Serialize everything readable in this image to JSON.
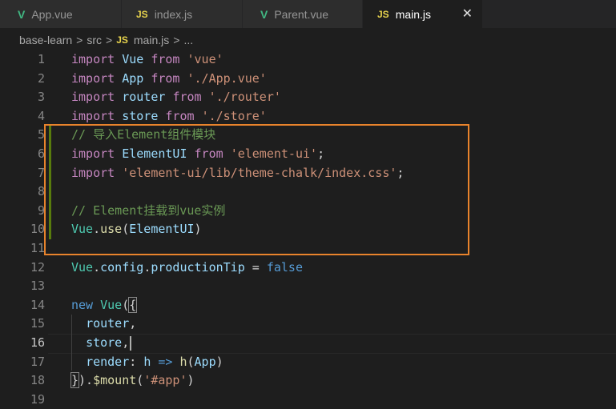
{
  "tabs": [
    {
      "label": "App.vue",
      "icon": "vue-icon"
    },
    {
      "label": "index.js",
      "icon": "js-icon"
    },
    {
      "label": "Parent.vue",
      "icon": "vue-icon"
    },
    {
      "label": "main.js",
      "icon": "js-icon"
    }
  ],
  "tab_icons": {
    "vue": "V",
    "js": "JS",
    "close": "✕"
  },
  "breadcrumb": {
    "root": "base-learn",
    "folder": "src",
    "file": "main.js",
    "more": "...",
    "separator": ">"
  },
  "lines": [
    {
      "n": "1",
      "t": [
        [
          "import",
          "kw"
        ],
        [
          " "
        ],
        [
          "Vue",
          "id"
        ],
        [
          " "
        ],
        [
          "from",
          "kw"
        ],
        [
          " "
        ],
        [
          "'vue'",
          "str"
        ]
      ]
    },
    {
      "n": "2",
      "t": [
        [
          "import",
          "kw"
        ],
        [
          " "
        ],
        [
          "App",
          "id"
        ],
        [
          " "
        ],
        [
          "from",
          "kw"
        ],
        [
          " "
        ],
        [
          "'./App.vue'",
          "str"
        ]
      ]
    },
    {
      "n": "3",
      "t": [
        [
          "import",
          "kw"
        ],
        [
          " "
        ],
        [
          "router",
          "id"
        ],
        [
          " "
        ],
        [
          "from",
          "kw"
        ],
        [
          " "
        ],
        [
          "'./router'",
          "str"
        ]
      ]
    },
    {
      "n": "4",
      "t": [
        [
          "import",
          "kw"
        ],
        [
          " "
        ],
        [
          "store",
          "id"
        ],
        [
          " "
        ],
        [
          "from",
          "kw"
        ],
        [
          " "
        ],
        [
          "'./store'",
          "str"
        ]
      ]
    },
    {
      "n": "5",
      "t": [
        [
          "// 导入Element组件模块",
          "cm"
        ]
      ]
    },
    {
      "n": "6",
      "t": [
        [
          "import",
          "kw"
        ],
        [
          " "
        ],
        [
          "ElementUI",
          "id"
        ],
        [
          " "
        ],
        [
          "from",
          "kw"
        ],
        [
          " "
        ],
        [
          "'element-ui'",
          "str"
        ],
        [
          ";"
        ]
      ]
    },
    {
      "n": "7",
      "t": [
        [
          "import",
          "kw"
        ],
        [
          " "
        ],
        [
          "'element-ui/lib/theme-chalk/index.css'",
          "str"
        ],
        [
          ";"
        ]
      ]
    },
    {
      "n": "8",
      "t": []
    },
    {
      "n": "9",
      "t": [
        [
          "// Element挂载到vue实例",
          "cm"
        ]
      ]
    },
    {
      "n": "10",
      "t": [
        [
          "Vue",
          "cls"
        ],
        [
          "."
        ],
        [
          "use",
          "fn"
        ],
        [
          "("
        ],
        [
          "ElementUI",
          "id"
        ],
        [
          ")"
        ]
      ]
    },
    {
      "n": "11",
      "t": []
    },
    {
      "n": "12",
      "t": [
        [
          "Vue",
          "cls"
        ],
        [
          "."
        ],
        [
          "config",
          "id"
        ],
        [
          "."
        ],
        [
          "productionTip",
          "id"
        ],
        [
          " = "
        ],
        [
          "false",
          "k"
        ]
      ]
    },
    {
      "n": "13",
      "t": []
    },
    {
      "n": "14",
      "t": [
        [
          "new",
          "k"
        ],
        [
          " "
        ],
        [
          "Vue",
          "cls"
        ],
        [
          "("
        ],
        [
          "{",
          "br"
        ]
      ]
    },
    {
      "n": "15",
      "t": [
        [
          "  "
        ],
        [
          "router",
          "id"
        ],
        [
          ","
        ]
      ]
    },
    {
      "n": "16",
      "t": [
        [
          "  "
        ],
        [
          "store",
          "id"
        ],
        [
          ","
        ],
        [
          "",
          "caret"
        ]
      ]
    },
    {
      "n": "17",
      "t": [
        [
          "  "
        ],
        [
          "render",
          "id"
        ],
        [
          ": "
        ],
        [
          "h",
          "id"
        ],
        [
          " "
        ],
        [
          "=>",
          "k"
        ],
        [
          " "
        ],
        [
          "h",
          "fn"
        ],
        [
          "("
        ],
        [
          "App",
          "id"
        ],
        [
          ")"
        ]
      ]
    },
    {
      "n": "18",
      "t": [
        [
          "}",
          "br"
        ],
        [
          ")."
        ],
        [
          "$mount",
          "fn"
        ],
        [
          "("
        ],
        [
          "'#app'",
          "str"
        ],
        [
          ")"
        ]
      ]
    },
    {
      "n": "19",
      "t": []
    }
  ]
}
